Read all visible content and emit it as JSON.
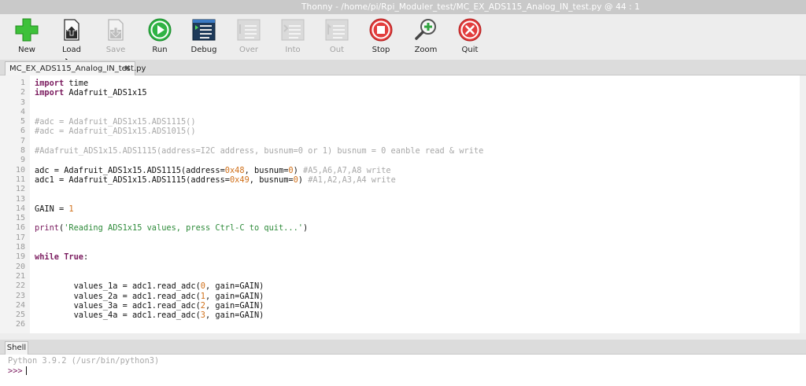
{
  "window": {
    "title": "Thonny  -  /home/pi/Rpi_Moduler_test/MC_EX_ADS115_Analog_IN_test.py  @  44 : 1"
  },
  "toolbar": {
    "items": [
      {
        "label": "New",
        "icon": "new-icon",
        "enabled": true
      },
      {
        "label": "Load",
        "icon": "load-icon",
        "enabled": true
      },
      {
        "label": "Save",
        "icon": "save-icon",
        "enabled": false
      },
      {
        "label": "Run",
        "icon": "run-icon",
        "enabled": true
      },
      {
        "label": "Debug",
        "icon": "debug-icon",
        "enabled": true
      },
      {
        "label": "Over",
        "icon": "step-over-icon",
        "enabled": false
      },
      {
        "label": "Into",
        "icon": "step-into-icon",
        "enabled": false
      },
      {
        "label": "Out",
        "icon": "step-out-icon",
        "enabled": false
      },
      {
        "label": "Stop",
        "icon": "stop-icon",
        "enabled": true
      },
      {
        "label": "Zoom",
        "icon": "zoom-icon",
        "enabled": true
      },
      {
        "label": "Quit",
        "icon": "quit-icon",
        "enabled": true
      }
    ]
  },
  "editor": {
    "tab_label": "MC_EX_ADS115_Analog_IN_test.py",
    "tab_close": "✖",
    "line_numbers": [
      "1",
      "2",
      "3",
      "4",
      "5",
      "6",
      "7",
      "8",
      "9",
      "10",
      "11",
      "12",
      "13",
      "14",
      "15",
      "16",
      "17",
      "18",
      "19",
      "20",
      "21",
      "22",
      "23",
      "24",
      "25",
      "26"
    ],
    "lines": {
      "l1_kw": "import",
      "l1_rest": " time",
      "l2_kw": "import",
      "l2_rest": " Adafruit_ADS1x15",
      "l5": "#adc = Adafruit_ADS1x15.ADS1115()",
      "l6": "#adc = Adafruit_ADS1x15.ADS1015()",
      "l8": "#Adafruit_ADS1x15.ADS1115(address=I2C address, busnum=0 or 1) busnum = 0 eanble read & write",
      "l10_a": "adc = Adafruit_ADS1x15.ADS1115(address=",
      "l10_n1": "0x48",
      "l10_b": ", busnum=",
      "l10_n2": "0",
      "l10_c": ") ",
      "l10_cm": "#A5,A6,A7,A8 write",
      "l11_a": "adc1 = Adafruit_ADS1x15.ADS1115(address=",
      "l11_n1": "0x49",
      "l11_b": ", busnum=",
      "l11_n2": "0",
      "l11_c": ") ",
      "l11_cm": "#A1,A2,A3,A4 write",
      "l14_a": "GAIN = ",
      "l14_n": "1",
      "l16_fn": "print",
      "l16_a": "(",
      "l16_s": "'Reading ADS1x15 values, press Ctrl-C to quit...'",
      "l16_b": ")",
      "l19_kw": "while",
      "l19_kw2": "True",
      "l19_rest": ":",
      "l22_a": "        values_1a = adc1.read_adc(",
      "l22_n": "0",
      "l22_b": ", gain=GAIN)",
      "l23_a": "        values_2a = adc1.read_adc(",
      "l23_n": "1",
      "l23_b": ", gain=GAIN)",
      "l24_a": "        values_3a = adc1.read_adc(",
      "l24_n": "2",
      "l24_b": ", gain=GAIN)",
      "l25_a": "        values_4a = adc1.read_adc(",
      "l25_n": "3",
      "l25_b": ", gain=GAIN)"
    }
  },
  "shell": {
    "tab_label": "Shell",
    "banner": "Python 3.9.2 (/usr/bin/python3)",
    "prompt": ">>>"
  },
  "colors": {
    "keyword": "#7a1a5e",
    "comment": "#a8a8a8",
    "number": "#d0701a",
    "string": "#2e8b3a"
  }
}
